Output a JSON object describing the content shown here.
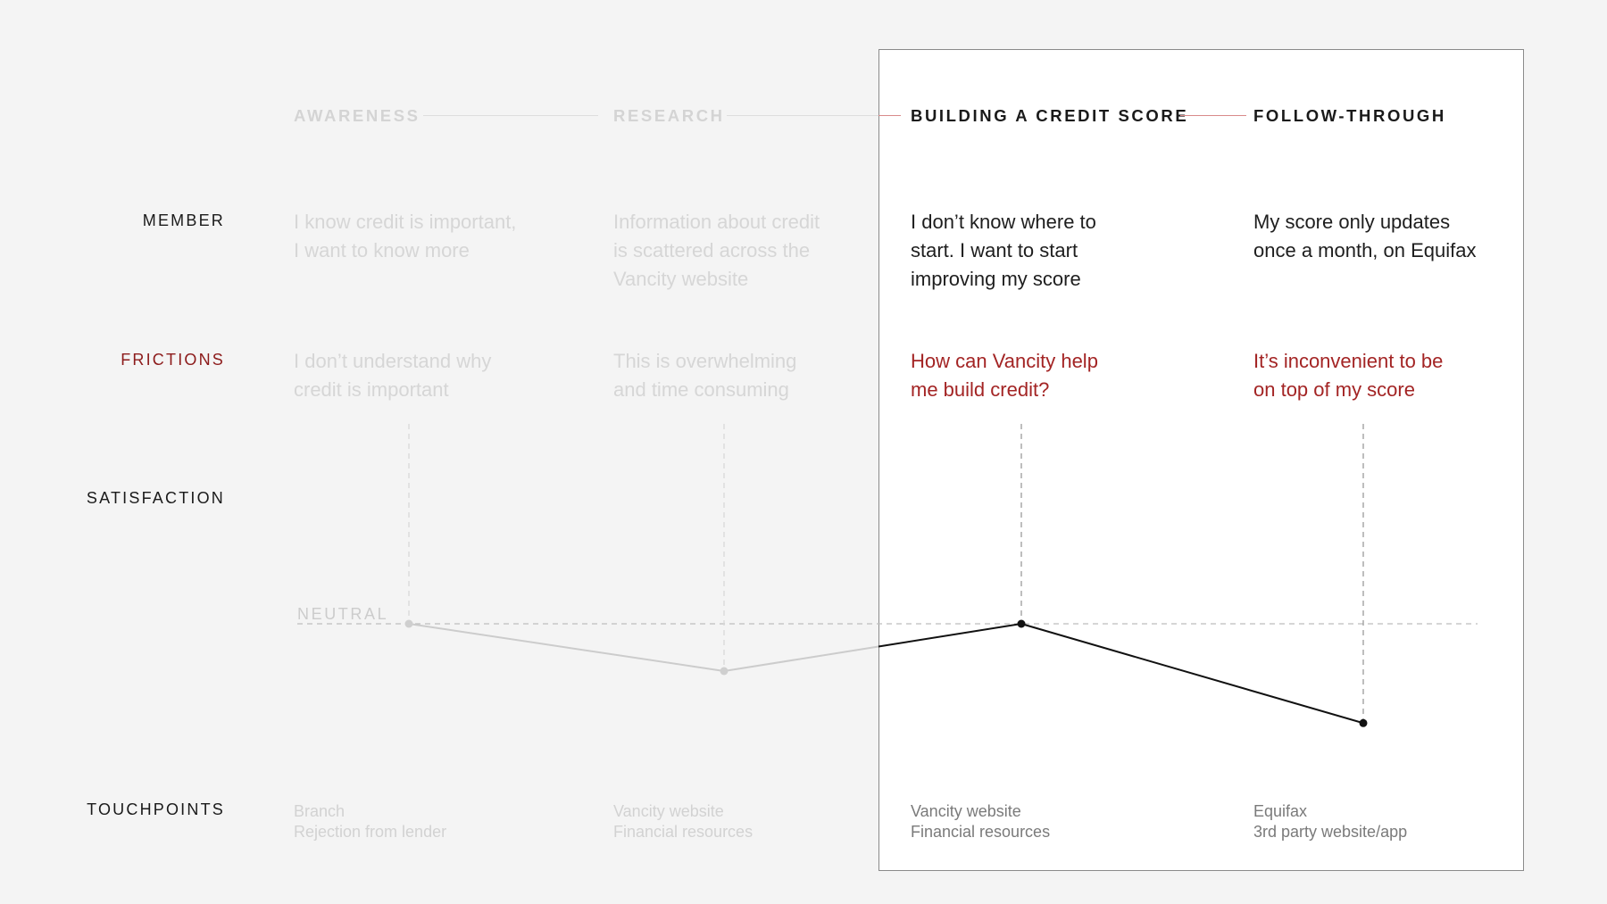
{
  "row_labels": {
    "member": "MEMBER",
    "frictions": "FRICTIONS",
    "satisfaction": "SATISFACTION",
    "touchpoints": "TOUCHPOINTS"
  },
  "stages": [
    {
      "name": "AWARENESS",
      "member": [
        "I know credit is important,",
        "I want to know more"
      ],
      "friction": [
        "I don’t understand why",
        "credit is important"
      ],
      "touchpoints": [
        "Branch",
        "Rejection from lender"
      ]
    },
    {
      "name": "RESEARCH",
      "member": [
        "Information about credit",
        "is scattered across the",
        "Vancity website"
      ],
      "friction": [
        "This is overwhelming",
        "and time consuming"
      ],
      "touchpoints": [
        "Vancity website",
        "Financial resources"
      ]
    },
    {
      "name": "BUILDING A CREDIT SCORE",
      "member": [
        "I don’t know where to",
        "start. I want to start",
        "improving my score"
      ],
      "friction": [
        "How can Vancity help",
        "me build credit?"
      ],
      "touchpoints": [
        "Vancity website",
        "Financial resources"
      ]
    },
    {
      "name": "FOLLOW-THROUGH",
      "member": [
        "My score only updates",
        "once a month, on Equifax"
      ],
      "friction": [
        "It’s inconvenient to be",
        "on top of my score"
      ],
      "touchpoints": [
        "Equifax",
        "3rd party website/app"
      ]
    }
  ],
  "neutral_label": "NEUTRAL",
  "chart_data": {
    "type": "line",
    "categories": [
      "AWARENESS",
      "RESEARCH",
      "BUILDING A CREDIT SCORE",
      "FOLLOW-THROUGH"
    ],
    "values": [
      0,
      -1,
      0,
      -2.1
    ],
    "baseline": 0,
    "baseline_label": "NEUTRAL",
    "highlighted_categories": [
      "BUILDING A CREDIT SCORE",
      "FOLLOW-THROUGH"
    ]
  },
  "colors": {
    "background": "#f4f4f4",
    "focus_panel": "#ffffff",
    "accent_red": "#a32424",
    "text_dark": "#1a1a1a",
    "text_faded": "#d6d6d6",
    "line_active": "#111111",
    "line_faded": "#cccccc"
  }
}
